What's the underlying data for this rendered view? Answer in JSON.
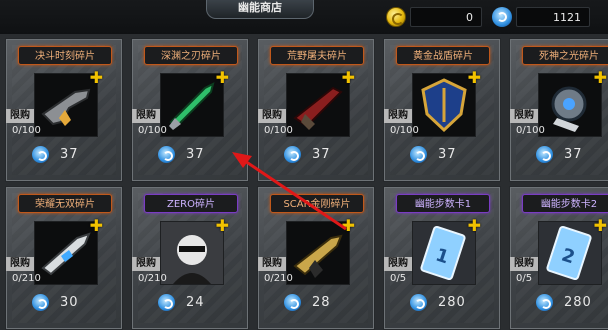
{
  "header": {
    "title": "幽能商店",
    "gold_amount": "0",
    "psi_amount": "1121"
  },
  "colors": {
    "name_orange": "#c0581b",
    "name_purple": "#7a3cc4",
    "arrow": "#e01818"
  },
  "items": [
    {
      "name": "决斗时刻碎片",
      "badge": "限购",
      "count": "0/100",
      "price": "37",
      "icon": "gun-icon"
    },
    {
      "name": "深渊之刃碎片",
      "badge": "限购",
      "count": "0/100",
      "price": "37",
      "icon": "blade-icon"
    },
    {
      "name": "荒野屠夫碎片",
      "badge": "限购",
      "count": "0/100",
      "price": "37",
      "icon": "shotgun-icon"
    },
    {
      "name": "黄金战盾碎片",
      "badge": "限购",
      "count": "0/100",
      "price": "37",
      "icon": "shield-icon"
    },
    {
      "name": "死神之光碎片",
      "badge": "限购",
      "count": "0/100",
      "price": "37",
      "icon": "cannon-icon"
    },
    {
      "name": "荣耀无双碎片",
      "badge": "限购",
      "count": "0/210",
      "price": "30",
      "icon": "rifle-icon"
    },
    {
      "name": "ZERO碎片",
      "badge": "限购",
      "count": "0/210",
      "price": "24",
      "icon": "character-icon"
    },
    {
      "name": "SCAR金刚碎片",
      "badge": "限购",
      "count": "0/210",
      "price": "28",
      "icon": "scar-rifle-icon"
    },
    {
      "name": "幽能步数卡1",
      "badge": "限购",
      "count": "0/5",
      "price": "280",
      "icon": "card-1-icon"
    },
    {
      "name": "幽能步数卡2",
      "badge": "限购",
      "count": "0/5",
      "price": "280",
      "icon": "card-2-icon"
    }
  ]
}
